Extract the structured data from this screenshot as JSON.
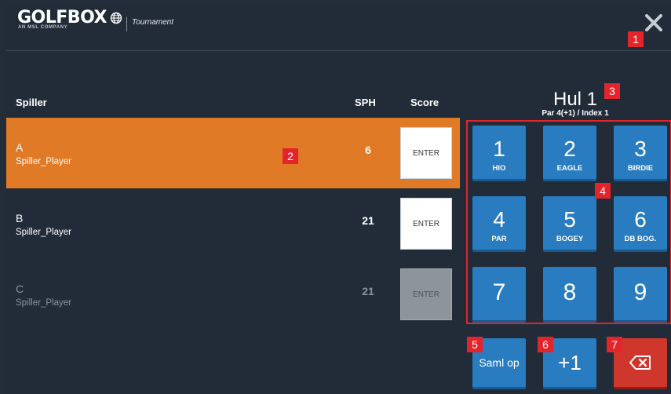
{
  "header": {
    "logo_text": "GOLFBOX",
    "logo_sub": "AN MSL COMPANY",
    "section": "Tournament",
    "close_icon": "close-icon"
  },
  "markers": [
    "1",
    "2",
    "3",
    "4",
    "5",
    "6",
    "7"
  ],
  "table": {
    "col_player": "Spiller",
    "col_hcp": "SPH",
    "col_score": "Score"
  },
  "players": [
    {
      "letter": "A",
      "name": "Spiller_Player",
      "hcp": "6",
      "button": "ENTER",
      "state": "active"
    },
    {
      "letter": "B",
      "name": "Spiller_Player",
      "hcp": "21",
      "button": "ENTER",
      "state": "normal"
    },
    {
      "letter": "C",
      "name": "Spiller_Player",
      "hcp": "21",
      "button": "ENTER",
      "state": "disabled"
    }
  ],
  "hole": {
    "title": "Hul 1",
    "subtitle": "Par 4(+1) / Index 1"
  },
  "keypad": [
    {
      "num": "1",
      "label": "HIO"
    },
    {
      "num": "2",
      "label": "EAGLE"
    },
    {
      "num": "3",
      "label": "BIRDIE"
    },
    {
      "num": "4",
      "label": "PAR"
    },
    {
      "num": "5",
      "label": "BOGEY"
    },
    {
      "num": "6",
      "label": "DB BOG."
    },
    {
      "num": "7",
      "label": ""
    },
    {
      "num": "8",
      "label": ""
    },
    {
      "num": "9",
      "label": ""
    }
  ],
  "actions": {
    "collect": "Saml op",
    "plus_one": "+1",
    "backspace_icon": "backspace-icon"
  },
  "colors": {
    "background": "#222c38",
    "accent_orange": "#e07a26",
    "key_blue": "#2a7cc0",
    "delete_red": "#d0372c",
    "marker_red": "#e3242b"
  }
}
